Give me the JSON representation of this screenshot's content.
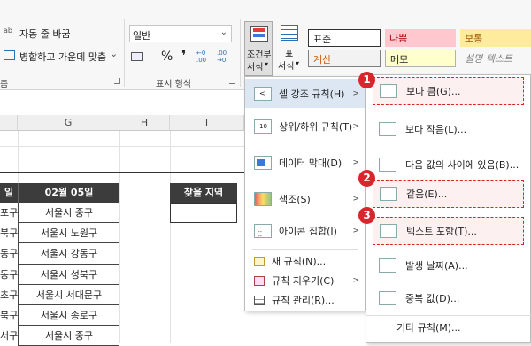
{
  "ribbon": {
    "wrap_text": "자동 줄 바꿈",
    "merge_center": "병합하고 가운데 맞춤",
    "merge_chevron": "⌄",
    "group_alignment_tail": "춤",
    "number_format": "일반",
    "percent": "%",
    "comma": "❜",
    "group_number": "표시 형식",
    "cond_format_line1": "조건부",
    "cond_format_line2": "서식",
    "table_format_line1": "표",
    "table_format_line2": "서식",
    "styles": {
      "normal": "표준",
      "bad": "나쁨",
      "neutral": "보통",
      "calc": "계산",
      "memo": "메모",
      "explanatory": "설명 텍스트"
    }
  },
  "sheet": {
    "col_g": "G",
    "col_h": "H",
    "col_i": "I",
    "header_left": "일",
    "header_g": "02월 05일",
    "search_label": "찾을 지역",
    "rows": [
      {
        "left": "포구",
        "g": "서울시 중구"
      },
      {
        "left": "북구",
        "g": "서울시 노원구"
      },
      {
        "left": "동구",
        "g": "서울시 강동구"
      },
      {
        "left": "동구",
        "g": "서울시 성북구"
      },
      {
        "left": "초구",
        "g": "서울시 서대문구"
      },
      {
        "left": "북구",
        "g": "서울시 종로구"
      },
      {
        "left": "서구",
        "g": "서울시 중구"
      }
    ]
  },
  "menu": {
    "items": [
      {
        "label": "셀 강조 규칙(H)"
      },
      {
        "label": "상위/하위 규칙(T)"
      },
      {
        "label": "데이터 막대(D)"
      },
      {
        "label": "색조(S)"
      },
      {
        "label": "아이콘 집합(I)"
      }
    ],
    "new_rule": "새 규칙(N)...",
    "clear_rules": "규칙 지우기(C)",
    "manage_rules": "규칙 관리(R)..."
  },
  "submenu": {
    "items": [
      {
        "label": "보다 큼(G)..."
      },
      {
        "label": "보다 작음(L)..."
      },
      {
        "label": "다음 값의 사이에 있음(B)..."
      },
      {
        "label": "같음(E)..."
      },
      {
        "label": "텍스트 포함(T)..."
      },
      {
        "label": "발생 날짜(A)..."
      },
      {
        "label": "중복 값(D)..."
      }
    ],
    "more_rules": "기타 규칙(M)..."
  },
  "badges": [
    "1",
    "2",
    "3"
  ],
  "colors": {
    "badge": "#d8262c",
    "highlight_border": "#dd2222",
    "header_dark": "#3c3c3c",
    "bad_bg": "#ffc7ce",
    "neutral_bg": "#ffeb9c",
    "calc_text": "#c65a11"
  },
  "icons": [
    "wrap-icon",
    "merge-icon",
    "currency-icon",
    "increase-decimal-icon",
    "decrease-decimal-icon",
    "conditional-format-icon",
    "table-format-icon",
    "chevron-right-icon"
  ]
}
